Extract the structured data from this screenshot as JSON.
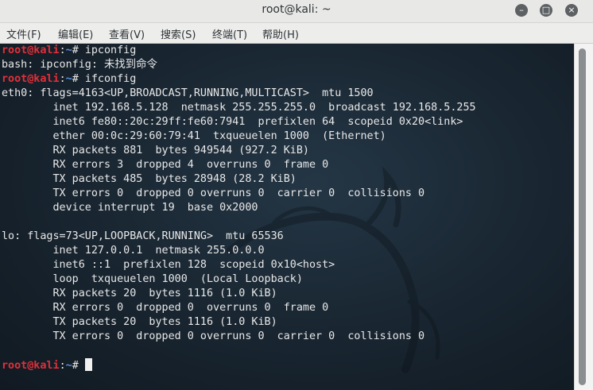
{
  "window": {
    "title": "root@kali: ~"
  },
  "menu": [
    "文件(F)",
    "编辑(E)",
    "查看(V)",
    "搜索(S)",
    "终端(T)",
    "帮助(H)"
  ],
  "prompt": {
    "user": "root@kali",
    "sep": ":",
    "path": "~",
    "sym": "# "
  },
  "terminal": {
    "lines": [
      {
        "type": "prompt",
        "cmd": "ipconfig"
      },
      {
        "type": "out",
        "text": "bash: ipconfig: 未找到命令"
      },
      {
        "type": "prompt",
        "cmd": "ifconfig"
      },
      {
        "type": "out",
        "text": "eth0: flags=4163<UP,BROADCAST,RUNNING,MULTICAST>  mtu 1500"
      },
      {
        "type": "out",
        "text": "        inet 192.168.5.128  netmask 255.255.255.0  broadcast 192.168.5.255"
      },
      {
        "type": "out",
        "text": "        inet6 fe80::20c:29ff:fe60:7941  prefixlen 64  scopeid 0x20<link>"
      },
      {
        "type": "out",
        "text": "        ether 00:0c:29:60:79:41  txqueuelen 1000  (Ethernet)"
      },
      {
        "type": "out",
        "text": "        RX packets 881  bytes 949544 (927.2 KiB)"
      },
      {
        "type": "out",
        "text": "        RX errors 3  dropped 4  overruns 0  frame 0"
      },
      {
        "type": "out",
        "text": "        TX packets 485  bytes 28948 (28.2 KiB)"
      },
      {
        "type": "out",
        "text": "        TX errors 0  dropped 0 overruns 0  carrier 0  collisions 0"
      },
      {
        "type": "out",
        "text": "        device interrupt 19  base 0x2000"
      },
      {
        "type": "out",
        "text": ""
      },
      {
        "type": "out",
        "text": "lo: flags=73<UP,LOOPBACK,RUNNING>  mtu 65536"
      },
      {
        "type": "out",
        "text": "        inet 127.0.0.1  netmask 255.0.0.0"
      },
      {
        "type": "out",
        "text": "        inet6 ::1  prefixlen 128  scopeid 0x10<host>"
      },
      {
        "type": "out",
        "text": "        loop  txqueuelen 1000  (Local Loopback)"
      },
      {
        "type": "out",
        "text": "        RX packets 20  bytes 1116 (1.0 KiB)"
      },
      {
        "type": "out",
        "text": "        RX errors 0  dropped 0  overruns 0  frame 0"
      },
      {
        "type": "out",
        "text": "        TX packets 20  bytes 1116 (1.0 KiB)"
      },
      {
        "type": "out",
        "text": "        TX errors 0  dropped 0 overruns 0  carrier 0  collisions 0"
      },
      {
        "type": "out",
        "text": ""
      },
      {
        "type": "prompt",
        "cmd": "",
        "cursor": true
      }
    ]
  }
}
